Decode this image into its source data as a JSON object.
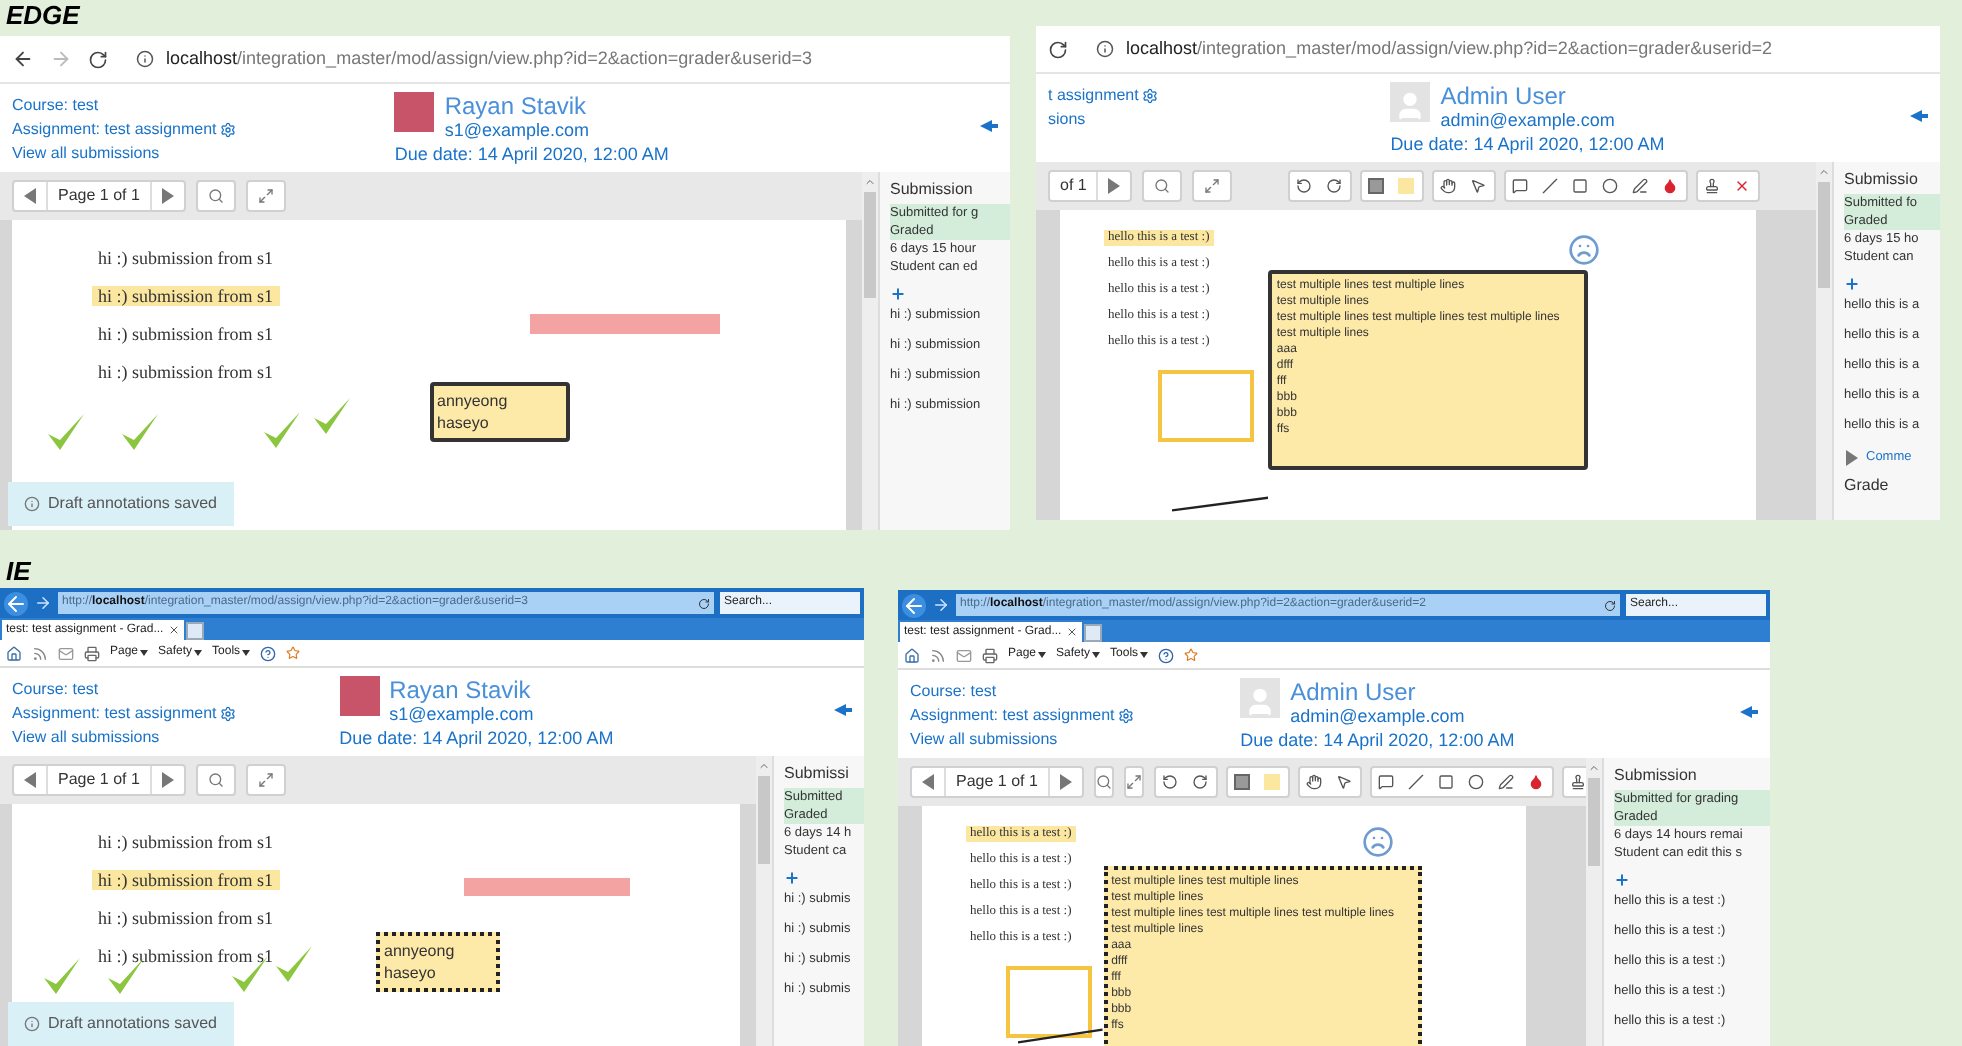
{
  "sections": [
    {
      "label": "EDGE",
      "screens": [
        {
          "kind": "edge",
          "nav_buttons": true,
          "url": {
            "host": "localhost",
            "path": "/integration_master/mod/assign/view.php?id=2&action=grader&userid=3"
          },
          "nav": [
            {
              "text": "Course: test",
              "settings_icon": false
            },
            {
              "text": "Assignment: test assignment",
              "settings_icon": true
            },
            {
              "text": "View all submissions",
              "settings_icon": false
            }
          ],
          "user": {
            "name": "Rayan Stavik",
            "email": "s1@example.com",
            "kind": "photo"
          },
          "due": "Due date: 14 April 2020, 12:00 AM",
          "pager": {
            "text": "Page 1 of 1",
            "prev_button": true
          },
          "annotation_tools": false,
          "document": {
            "kind": "student",
            "lines": [
              {
                "text": "hi :) submission from s1",
                "highlight": false
              },
              {
                "text": "hi :) submission from s1",
                "highlight": true
              },
              {
                "text": "hi :) submission from s1",
                "highlight": false
              },
              {
                "text": "hi :) submission from s1",
                "highlight": false
              }
            ],
            "comment": [
              "annyeong",
              "haseyo"
            ]
          },
          "notice": "Draft annotations saved",
          "sidebar": {
            "title": "Submission",
            "status": [
              {
                "text": "Submitted for g",
                "highlight": true
              },
              {
                "text": "Graded",
                "highlight": true
              },
              {
                "text": "6 days 15 hour",
                "highlight": false
              },
              {
                "text": "Student can ed",
                "highlight": false
              }
            ],
            "comments": [
              "hi :) submission",
              "hi :) submission",
              "hi :) submission",
              "hi :) submission"
            ]
          }
        },
        {
          "kind": "edge",
          "nav_buttons": false,
          "url": {
            "host": "localhost",
            "path": "/integration_master/mod/assign/view.php?id=2&action=grader&userid=2"
          },
          "nav": [
            {
              "text": "t assignment",
              "settings_icon": true
            },
            {
              "text": "sions",
              "settings_icon": false
            }
          ],
          "user": {
            "name": "Admin User",
            "email": "admin@example.com",
            "kind": "blank"
          },
          "due": "Due date: 14 April 2020, 12:00 AM",
          "pager": {
            "text": "of 1",
            "prev_button": false
          },
          "annotation_tools": true,
          "document": {
            "kind": "teacher",
            "lines": [
              {
                "text": "hello this is a test :)",
                "highlight": true
              },
              {
                "text": "hello this is a test :)",
                "highlight": false
              },
              {
                "text": "hello this is a test :)",
                "highlight": false
              },
              {
                "text": "hello this is a test :)",
                "highlight": false
              },
              {
                "text": "hello this is a test :)",
                "highlight": false
              }
            ],
            "comment": [
              "test multiple lines test multiple lines",
              "test multiple lines",
              "test multiple lines test multiple lines test multiple lines",
              "test multiple lines",
              "aaa",
              "dfff",
              "fff",
              "bbb",
              "bbb",
              "ffs"
            ]
          },
          "sidebar": {
            "title": "Submissio",
            "status": [
              {
                "text": "Submitted fo",
                "highlight": true
              },
              {
                "text": "Graded",
                "highlight": true
              },
              {
                "text": "6 days 15 ho",
                "highlight": false
              },
              {
                "text": "Student can",
                "highlight": false
              }
            ],
            "comments": [
              "hello this is a",
              "hello this is a",
              "hello this is a",
              "hello this is a",
              "hello this is a"
            ],
            "comments_link": "Comme",
            "grade": "Grade"
          }
        }
      ]
    },
    {
      "label": "IE",
      "screens": [
        {
          "kind": "ie",
          "url": {
            "scheme": "http://",
            "host": "localhost",
            "path": "/integration_master/mod/assign/view.php?id=2&action=grader&userid=3"
          },
          "ie": {
            "search": "Search...",
            "tab": "test: test assignment - Grad...",
            "menus": [
              "Page",
              "Safety",
              "Tools"
            ]
          },
          "nav": [
            {
              "text": "Course: test",
              "settings_icon": false
            },
            {
              "text": "Assignment: test assignment",
              "settings_icon": true
            },
            {
              "text": "View all submissions",
              "settings_icon": false
            }
          ],
          "user": {
            "name": "Rayan Stavik",
            "email": "s1@example.com",
            "kind": "photo"
          },
          "due": "Due date: 14 April 2020, 12:00 AM",
          "pager": {
            "text": "Page 1 of 1",
            "prev_button": true
          },
          "annotation_tools": false,
          "document": {
            "kind": "student",
            "lines": [
              {
                "text": "hi :) submission from s1",
                "highlight": false
              },
              {
                "text": "hi :) submission from s1",
                "highlight": true
              },
              {
                "text": "hi :) submission from s1",
                "highlight": false
              },
              {
                "text": "hi :) submission from s1",
                "highlight": false
              }
            ],
            "comment": [
              "annyeong",
              "haseyo"
            ]
          },
          "notice": "Draft annotations saved",
          "sidebar": {
            "title": "Submissi",
            "status": [
              {
                "text": "Submitted",
                "highlight": true
              },
              {
                "text": "Graded",
                "highlight": true
              },
              {
                "text": "6 days 14 h",
                "highlight": false
              },
              {
                "text": "Student ca",
                "highlight": false
              }
            ],
            "comments": [
              "hi :) submis",
              "hi :) submis",
              "hi :) submis",
              "hi :) submis"
            ]
          }
        },
        {
          "kind": "ie",
          "url": {
            "scheme": "http://",
            "host": "localhost",
            "path": "/integration_master/mod/assign/view.php?id=2&action=grader&userid=2"
          },
          "ie": {
            "search": "Search...",
            "tab": "test: test assignment - Grad...",
            "menus": [
              "Page",
              "Safety",
              "Tools"
            ]
          },
          "nav": [
            {
              "text": "Course: test",
              "settings_icon": false
            },
            {
              "text": "Assignment: test assignment",
              "settings_icon": true
            },
            {
              "text": "View all submissions",
              "settings_icon": false
            }
          ],
          "user": {
            "name": "Admin User",
            "email": "admin@example.com",
            "kind": "blank"
          },
          "due": "Due date: 14 April 2020, 12:00 AM",
          "pager": {
            "text": "Page 1 of 1",
            "prev_button": true
          },
          "annotation_tools": true,
          "document": {
            "kind": "teacher",
            "lines": [
              {
                "text": "hello this is a test :)",
                "highlight": true
              },
              {
                "text": "hello this is a test :)",
                "highlight": false
              },
              {
                "text": "hello this is a test :)",
                "highlight": false
              },
              {
                "text": "hello this is a test :)",
                "highlight": false
              },
              {
                "text": "hello this is a test :)",
                "highlight": false
              }
            ],
            "comment": [
              "test multiple lines test multiple lines",
              "test multiple lines",
              "test multiple lines test multiple lines test multiple lines",
              "test multiple lines",
              "aaa",
              "dfff",
              "fff",
              "bbb",
              "bbb",
              "ffs"
            ]
          },
          "sidebar": {
            "title": "Submission",
            "status": [
              {
                "text": "Submitted for grading",
                "highlight": true
              },
              {
                "text": "Graded",
                "highlight": true
              },
              {
                "text": "6 days 14 hours remai",
                "highlight": false
              },
              {
                "text": "Student can edit this s",
                "highlight": false
              }
            ],
            "comments": [
              "hello this is a test :)",
              "hello this is a test :)",
              "hello this is a test :)",
              "hello this is a test :)",
              "hello this is a test :)"
            ]
          }
        }
      ]
    }
  ]
}
